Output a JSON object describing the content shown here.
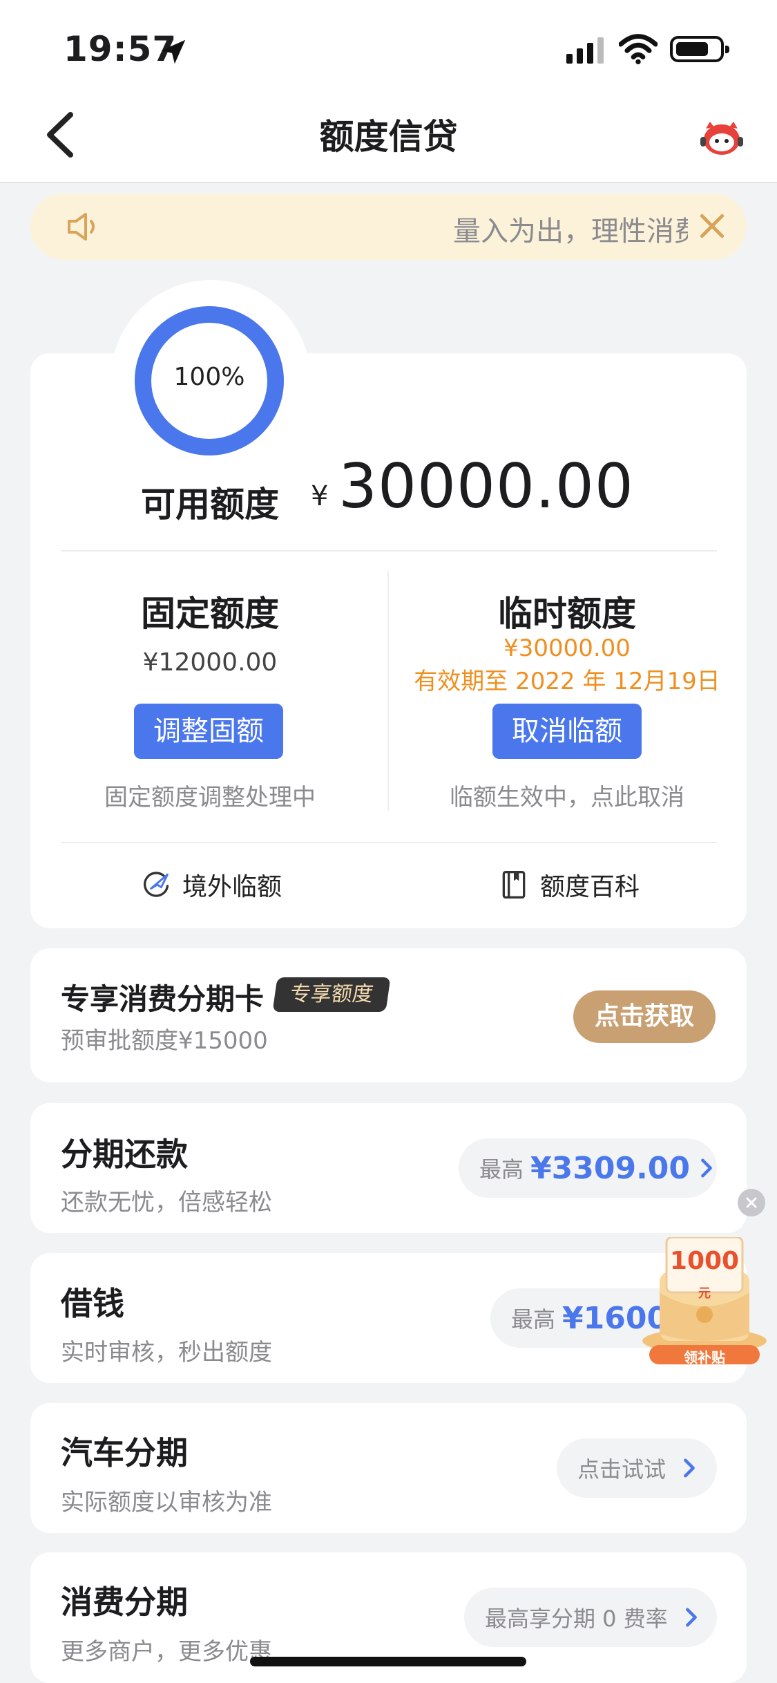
{
  "status_bar": {
    "time": "19:57"
  },
  "nav": {
    "title": "额度信贷"
  },
  "notice": {
    "text": "量入为出，理性消费"
  },
  "credit": {
    "percent_label": "100%",
    "percent": 1.0,
    "available_label": "可用额度",
    "currency": "¥",
    "available_amount": "30000.00",
    "fixed": {
      "title": "固定额度",
      "amount": "¥12000.00",
      "button": "调整固额",
      "note": "固定额度调整处理中"
    },
    "temporary": {
      "title": "临时额度",
      "amount": "¥30000.00",
      "valid": "有效期至 2022 年 12月19日",
      "button": "取消临额",
      "note": "临额生效中，点此取消"
    },
    "links": {
      "overseas": "境外临额",
      "wiki": "额度百科"
    }
  },
  "promo": {
    "title": "专享消费分期卡",
    "badge": "专享额度",
    "subtitle": "预审批额度¥15000",
    "button": "点击获取"
  },
  "products": [
    {
      "title": "分期还款",
      "subtitle": "还款无忧，倍感轻松",
      "pill_label": "最高",
      "pill_value": "¥3309.00"
    },
    {
      "title": "借钱",
      "subtitle": "实时审核，秒出额度",
      "pill_label": "最高",
      "pill_value": "¥1600"
    },
    {
      "title": "汽车分期",
      "subtitle": "实际额度以审核为准",
      "pill_label": "点击试试",
      "pill_value": ""
    },
    {
      "title": "消费分期",
      "subtitle": "更多商户，更多优惠",
      "pill_label": "最高享分期 0 费率",
      "pill_value": ""
    }
  ],
  "floating": {
    "amount": "1000",
    "unit": "元",
    "label": "领补贴"
  },
  "colors": {
    "accent": "#4b77ec",
    "orange": "#ef8f1f",
    "gold": "#c9a072"
  }
}
